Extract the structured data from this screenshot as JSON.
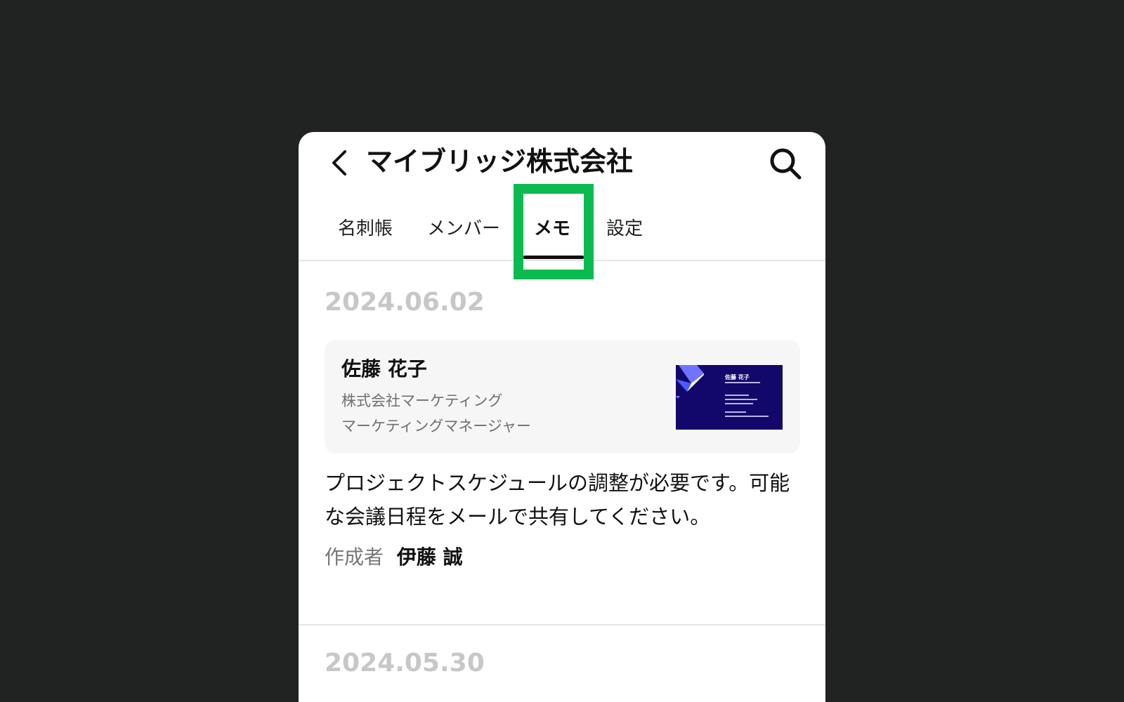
{
  "header": {
    "title": "マイブリッジ株式会社"
  },
  "tabs": [
    {
      "label": "名刺帳",
      "active": false
    },
    {
      "label": "メンバー",
      "active": false
    },
    {
      "label": "メモ",
      "active": true
    },
    {
      "label": "設定",
      "active": false
    }
  ],
  "memos": [
    {
      "date": "2024.06.02",
      "card": {
        "name": "佐藤 花子",
        "company": "株式会社マーケティング",
        "role": "マーケティングマネージャー",
        "thumbnail_name": "佐藤 花子"
      },
      "text": "プロジェクトスケジュールの調整が必要です。可能な会議日程をメールで共有してください。",
      "author_label": "作成者",
      "author_name": "伊藤 誠"
    },
    {
      "date": "2024.05.30"
    }
  ],
  "colors": {
    "background": "#212322",
    "highlight": "#0bbb4f",
    "card_bg": "#f6f6f6",
    "bizcard_bg": "#12086b",
    "date_text": "#c7c7c7"
  }
}
